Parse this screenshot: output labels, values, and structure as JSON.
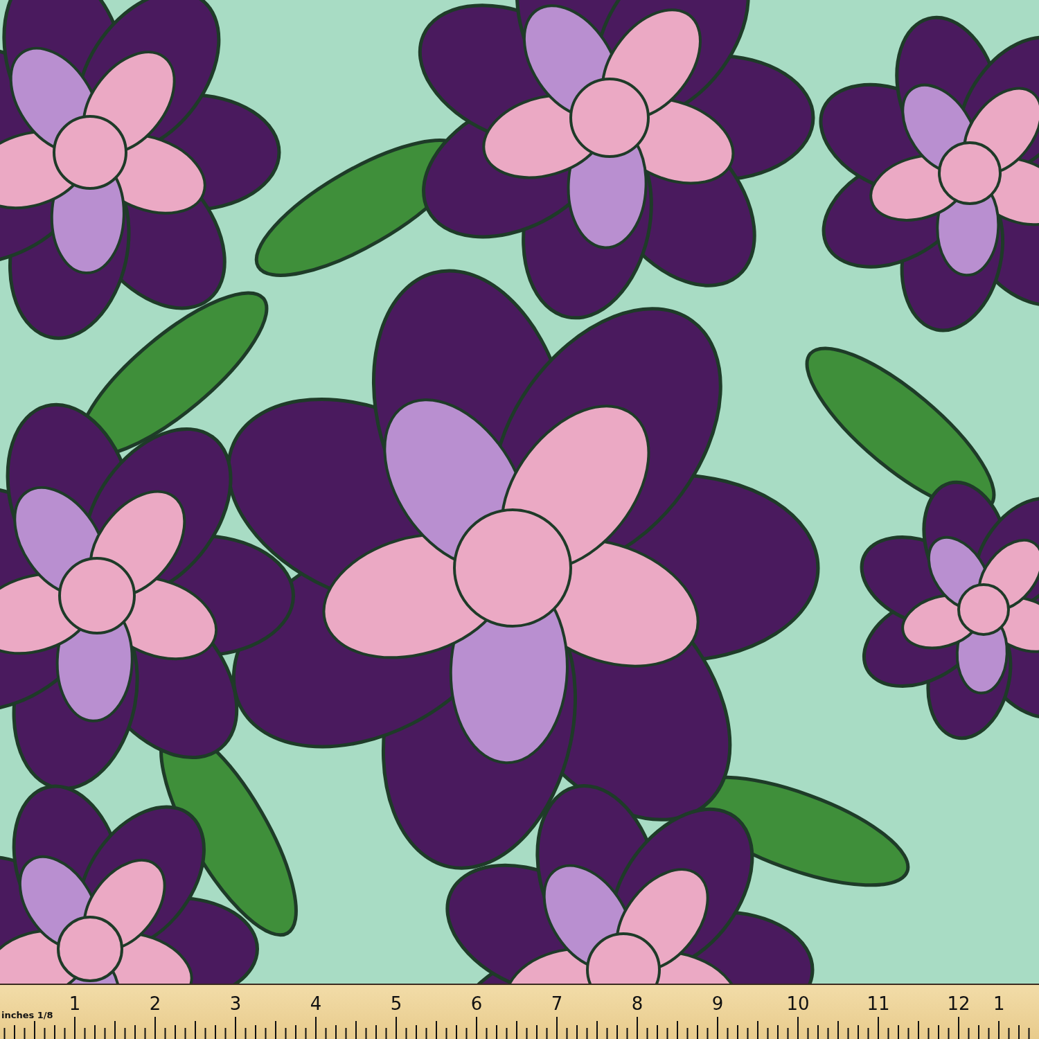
{
  "ruler": {
    "caption": "inches 1/8",
    "numbers": [
      "1",
      "2",
      "3",
      "4",
      "5",
      "6",
      "7",
      "8",
      "9",
      "10",
      "11",
      "12",
      "1"
    ]
  }
}
